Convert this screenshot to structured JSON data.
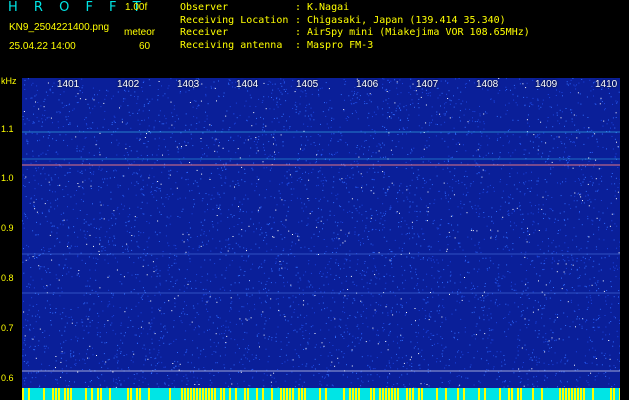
{
  "header": {
    "brand": "H R O F F T",
    "version": "1.00f",
    "filename": "KN9_2504221400.png",
    "meteor_label": "meteor",
    "datetime": "25.04.22 14:00",
    "meteor_count": "60",
    "info": [
      {
        "key": "Observer",
        "value": "K.Nagai"
      },
      {
        "key": "Receiving Location",
        "value": "Chigasaki, Japan (139.414 35.340)"
      },
      {
        "key": "Receiver",
        "value": "AirSpy mini (Miakejima VOR 108.65MHz)"
      },
      {
        "key": "Receiving antenna",
        "value": "Maspro FM-3"
      }
    ]
  },
  "y_axis": {
    "unit": "kHz",
    "ticks": [
      "1.1",
      "1.0",
      "0.9",
      "0.8",
      "0.7",
      "0.6"
    ]
  },
  "x_axis": {
    "ticks": [
      "1401",
      "1402",
      "1403",
      "1404",
      "1405",
      "1406",
      "1407",
      "1408",
      "1409",
      "1410"
    ]
  },
  "colors": {
    "background_noise": "#0a1f99",
    "noise_speckle": "#2f6bff",
    "noise_bright": "#ffffff",
    "carrier": "#ff8080",
    "bottom_band": "#00e5e5",
    "bottom_band_hot": "#ffff00",
    "label_yellow": "#ffff00",
    "brand_cyan": "#00e5e5"
  }
}
